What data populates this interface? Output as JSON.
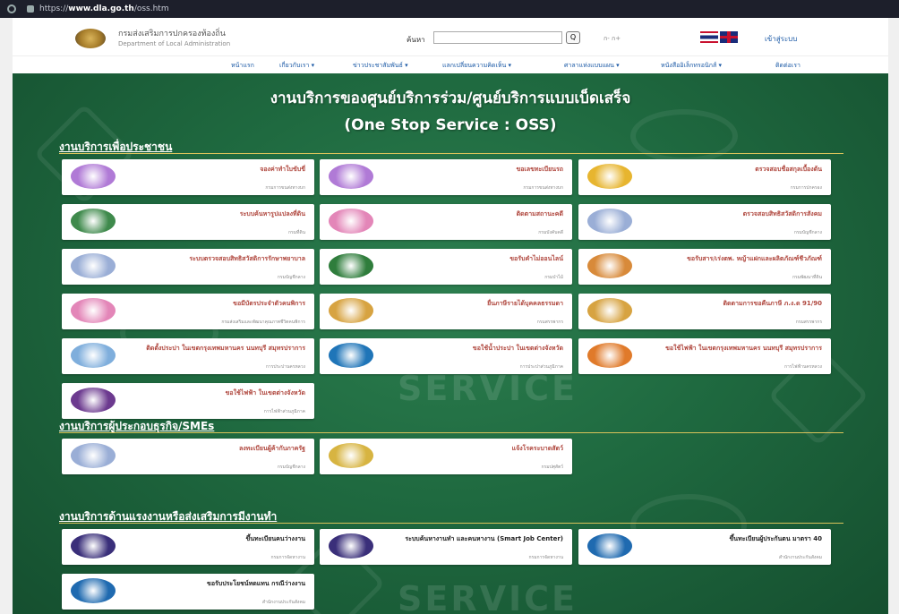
{
  "browser": {
    "url_prefix": "https://",
    "url_domain": "www.dla.go.th",
    "url_path": "/oss.htm"
  },
  "header": {
    "org_name_th": "กรมส่งเสริมการปกครองท้องถิ่น",
    "org_name_en": "Department of Local Administration",
    "search_label": "ค้นหา",
    "search_placeholder": "",
    "search_button": "Q",
    "font_size_controls": "ก- ก+",
    "login_link": "เข้าสู่ระบบ"
  },
  "nav": [
    "หน้าแรก",
    "เกี่ยวกับเรา ▾",
    "ข่าวประชาสัมพันธ์ ▾",
    "แลกเปลี่ยนความคิดเห็น ▾",
    "ศาลาแห่งแบบแผน ▾",
    "หนังสืออิเล็กทรอนิกส์ ▾",
    "ติดต่อเรา"
  ],
  "hero": {
    "title_line1": "งานบริการของศูนย์บริการร่วม/ศูนย์บริการแบบเบ็ดเสร็จ",
    "title_line2": "(One Stop Service : OSS)",
    "watermark_word": "SERVICE"
  },
  "sections": {
    "people": {
      "title": "งานบริการเพื่อประชาชน",
      "cards": [
        {
          "title": "จองค่าทำใบขับขี่",
          "sub": "กรมการขนส่งทางบก",
          "logo_color": "#b07ad6"
        },
        {
          "title": "ขอเลขทะเบียนรถ",
          "sub": "กรมการขนส่งทางบก",
          "logo_color": "#b07ad6"
        },
        {
          "title": "ตรวจสอบชื่อสกุลเบื้องต้น",
          "sub": "กรมการปกครอง",
          "logo_color": "#e7b52f"
        },
        {
          "title": "ระบบค้นหารูปแปลงที่ดิน",
          "sub": "กรมที่ดิน",
          "logo_color": "#3f8a4c"
        },
        {
          "title": "ติดตามสถานะคดี",
          "sub": "กรมบังคับคดี",
          "logo_color": "#e386b8"
        },
        {
          "title": "ตรวจสอบสิทธิสวัสดิการสังคม",
          "sub": "กรมบัญชีกลาง",
          "logo_color": "#9aaed6"
        },
        {
          "title": "ระบบตรวจสอบสิทธิสวัสดิการรักษาพยาบาล",
          "sub": "กรมบัญชีกลาง",
          "logo_color": "#9aaed6"
        },
        {
          "title": "ขอรับคำไม่ออนไลน์",
          "sub": "กรมป่าไม้",
          "logo_color": "#2f7d3c"
        },
        {
          "title": "ขอรับสาร/เร่งตพ. หญ้าแฝกและผลิตภัณฑ์ชีวภัณฑ์",
          "sub": "กรมพัฒนาที่ดิน",
          "logo_color": "#d88a3a"
        },
        {
          "title": "ขอมีบัตรประจำตัวคนพิการ",
          "sub": "กรมส่งเสริมและพัฒนาคุณภาพชีวิตคนพิการ",
          "logo_color": "#e386b8"
        },
        {
          "title": "ยื่นภาษีรายได้บุคคลธรรมดา",
          "sub": "กรมสรรพากร",
          "logo_color": "#d7a341"
        },
        {
          "title": "ติดตามการขอคืนภาษี ภ.ง.ด 91/90",
          "sub": "กรมสรรพากร",
          "logo_color": "#d7a341"
        },
        {
          "title": "ติดตั้งประปา ในเขตกรุงเทพมหานคร นนทบุรี สมุทรปราการ",
          "sub": "การประปานครหลวง",
          "logo_color": "#7faedc"
        },
        {
          "title": "ขอใช้น้ำประปา ในเขตต่างจังหวัด",
          "sub": "การประปาส่วนภูมิภาค",
          "logo_color": "#1f75b8"
        },
        {
          "title": "ขอใช้ไฟฟ้า ในเขตกรุงเทพมหานคร นนทบุรี สมุทรปราการ",
          "sub": "การไฟฟ้านครหลวง",
          "logo_color": "#e07a2a"
        },
        {
          "title": "ขอใช้ไฟฟ้า ในเขตต่างจังหวัด",
          "sub": "การไฟฟ้าส่วนภูมิภาค",
          "logo_color": "#6c3a8f"
        }
      ]
    },
    "business": {
      "title": "งานบริการผู้ประกอบธุรกิจ/SMEs",
      "cards": [
        {
          "title": "ลงทะเบียนผู้ค้ากับภาครัฐ",
          "sub": "กรมบัญชีกลาง",
          "logo_color": "#9aaed6"
        },
        {
          "title": "แจ้งโรคระบาดสัตว์",
          "sub": "กรมปศุสัตว์",
          "logo_color": "#d7b441"
        }
      ]
    },
    "labor": {
      "title": "งานบริการด้านแรงงานหรือส่งเสริมการมีงานทำ",
      "cards": [
        {
          "title": "ขึ้นทะเบียนคนว่างงาน",
          "sub": "กรมการจัดหางาน",
          "logo_color": "#3a2f7a"
        },
        {
          "title": "ระบบค้นหางานทำ และคนหางาน (Smart Job Center)",
          "sub": "กรมการจัดหางาน",
          "logo_color": "#3a2f7a"
        },
        {
          "title": "ขึ้นทะเบียนผู้ประกันตน มาตรา 40",
          "sub": "สำนักงานประกันสังคม",
          "logo_color": "#1f6ab0"
        },
        {
          "title": "ขอรับประโยชน์ทดแทน กรณีว่างงาน",
          "sub": "สำนักงานประกันสังคม",
          "logo_color": "#1f6ab0"
        }
      ]
    }
  }
}
